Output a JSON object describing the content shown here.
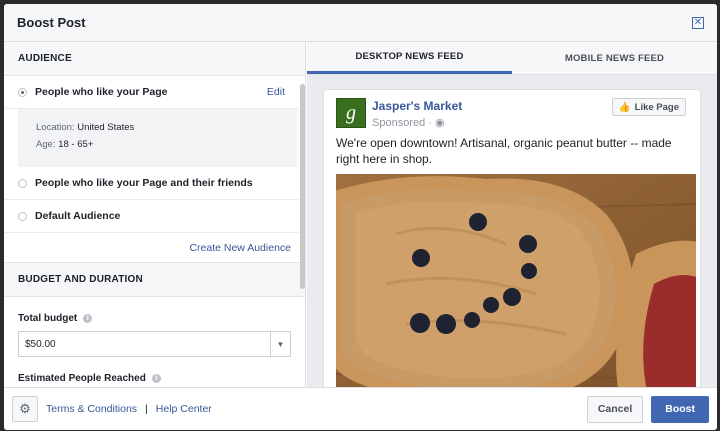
{
  "dialog": {
    "title": "Boost Post"
  },
  "audience": {
    "section_title": "AUDIENCE",
    "options": [
      {
        "label": "People who like your Page",
        "selected": true,
        "action": "Edit"
      },
      {
        "label": "People who like your Page and their friends",
        "selected": false
      },
      {
        "label": "Default Audience",
        "selected": false
      }
    ],
    "details": {
      "location_label": "Location:",
      "location_value": "United States",
      "age_label": "Age:",
      "age_value": "18 - 65+"
    },
    "create_link": "Create New Audience"
  },
  "budget": {
    "section_title": "BUDGET AND DURATION",
    "total_label": "Total budget",
    "total_value": "$50.00",
    "reach_label": "Estimated People Reached"
  },
  "tabs": [
    {
      "label": "DESKTOP NEWS FEED",
      "active": true
    },
    {
      "label": "MOBILE NEWS FEED",
      "active": false
    }
  ],
  "post": {
    "logo_letter": "g",
    "page_name": "Jasper's Market",
    "sponsored": "Sponsored ·",
    "like_button": "Like Page",
    "text": "We're open downtown! Artisanal, organic peanut butter -- made right here in shop."
  },
  "footer": {
    "terms": "Terms & Conditions",
    "separator": "|",
    "help": "Help Center",
    "cancel": "Cancel",
    "boost": "Boost"
  },
  "colors": {
    "accent": "#4267b2",
    "link": "#365899",
    "logo_bg": "#3a6e1f"
  }
}
